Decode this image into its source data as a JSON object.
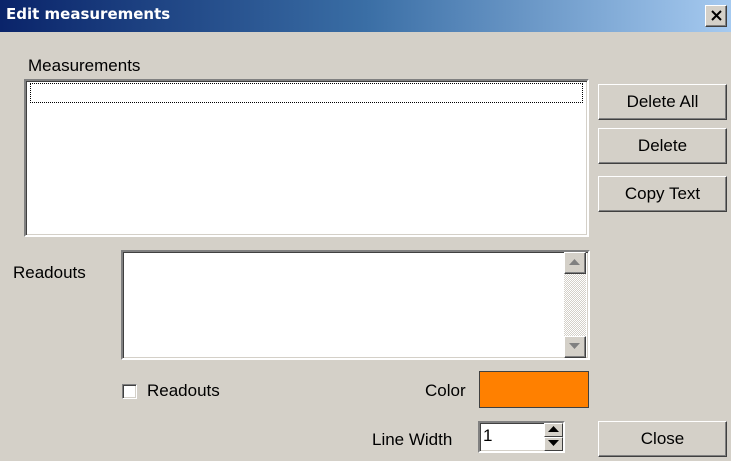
{
  "window": {
    "title": "Edit measurements",
    "close_glyph": "X"
  },
  "measurements": {
    "label": "Measurements",
    "items": [
      ""
    ]
  },
  "buttons": {
    "delete_all": "Delete All",
    "delete": "Delete",
    "copy_text": "Copy Text",
    "close": "Close"
  },
  "readouts": {
    "label": "Readouts",
    "text": "",
    "checkbox_label": "Readouts",
    "checkbox_checked": false
  },
  "color": {
    "label": "Color",
    "value": "#ff8000"
  },
  "line_width": {
    "label": "Line Width",
    "value": "1"
  }
}
